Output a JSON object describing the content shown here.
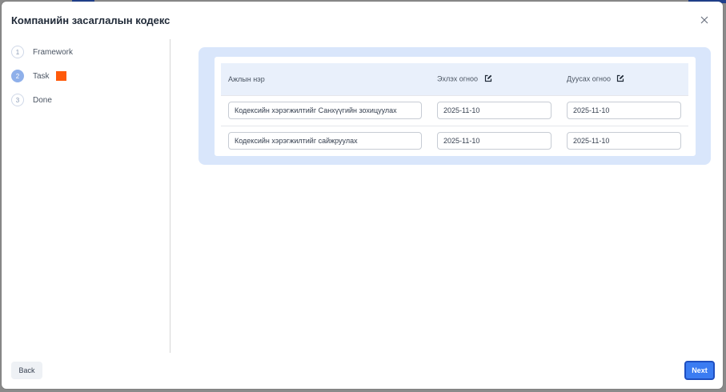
{
  "modal": {
    "title": "Компанийн засаглалын кодекс",
    "close_icon": "close-icon"
  },
  "steps": [
    {
      "number": "1",
      "label": "Framework",
      "state": "complete"
    },
    {
      "number": "2",
      "label": "Task",
      "state": "active",
      "marker_color": "#ff5a0a"
    },
    {
      "number": "3",
      "label": "Done",
      "state": "pending"
    }
  ],
  "table": {
    "headers": {
      "name": "Ажлын нэр",
      "start": "Эхлэх огноо",
      "end": "Дуусах огноо"
    },
    "header_edit_icon": "edit-icon",
    "rows": [
      {
        "name": "Кодексийн хэрэгжилтийг Санхүүгийн зохицуулах",
        "start": "2025-11-10",
        "end": "2025-11-10"
      },
      {
        "name": "Кодексийн хэрэгжилтийг сайжруулах",
        "start": "2025-11-10",
        "end": "2025-11-10"
      }
    ]
  },
  "footer": {
    "back_label": "Back",
    "next_label": "Next"
  },
  "colors": {
    "accent": "#3b7cf2",
    "card_background": "#d9e6fb",
    "active_step": "#8fb0ea",
    "task_marker": "#ff5a0a"
  }
}
